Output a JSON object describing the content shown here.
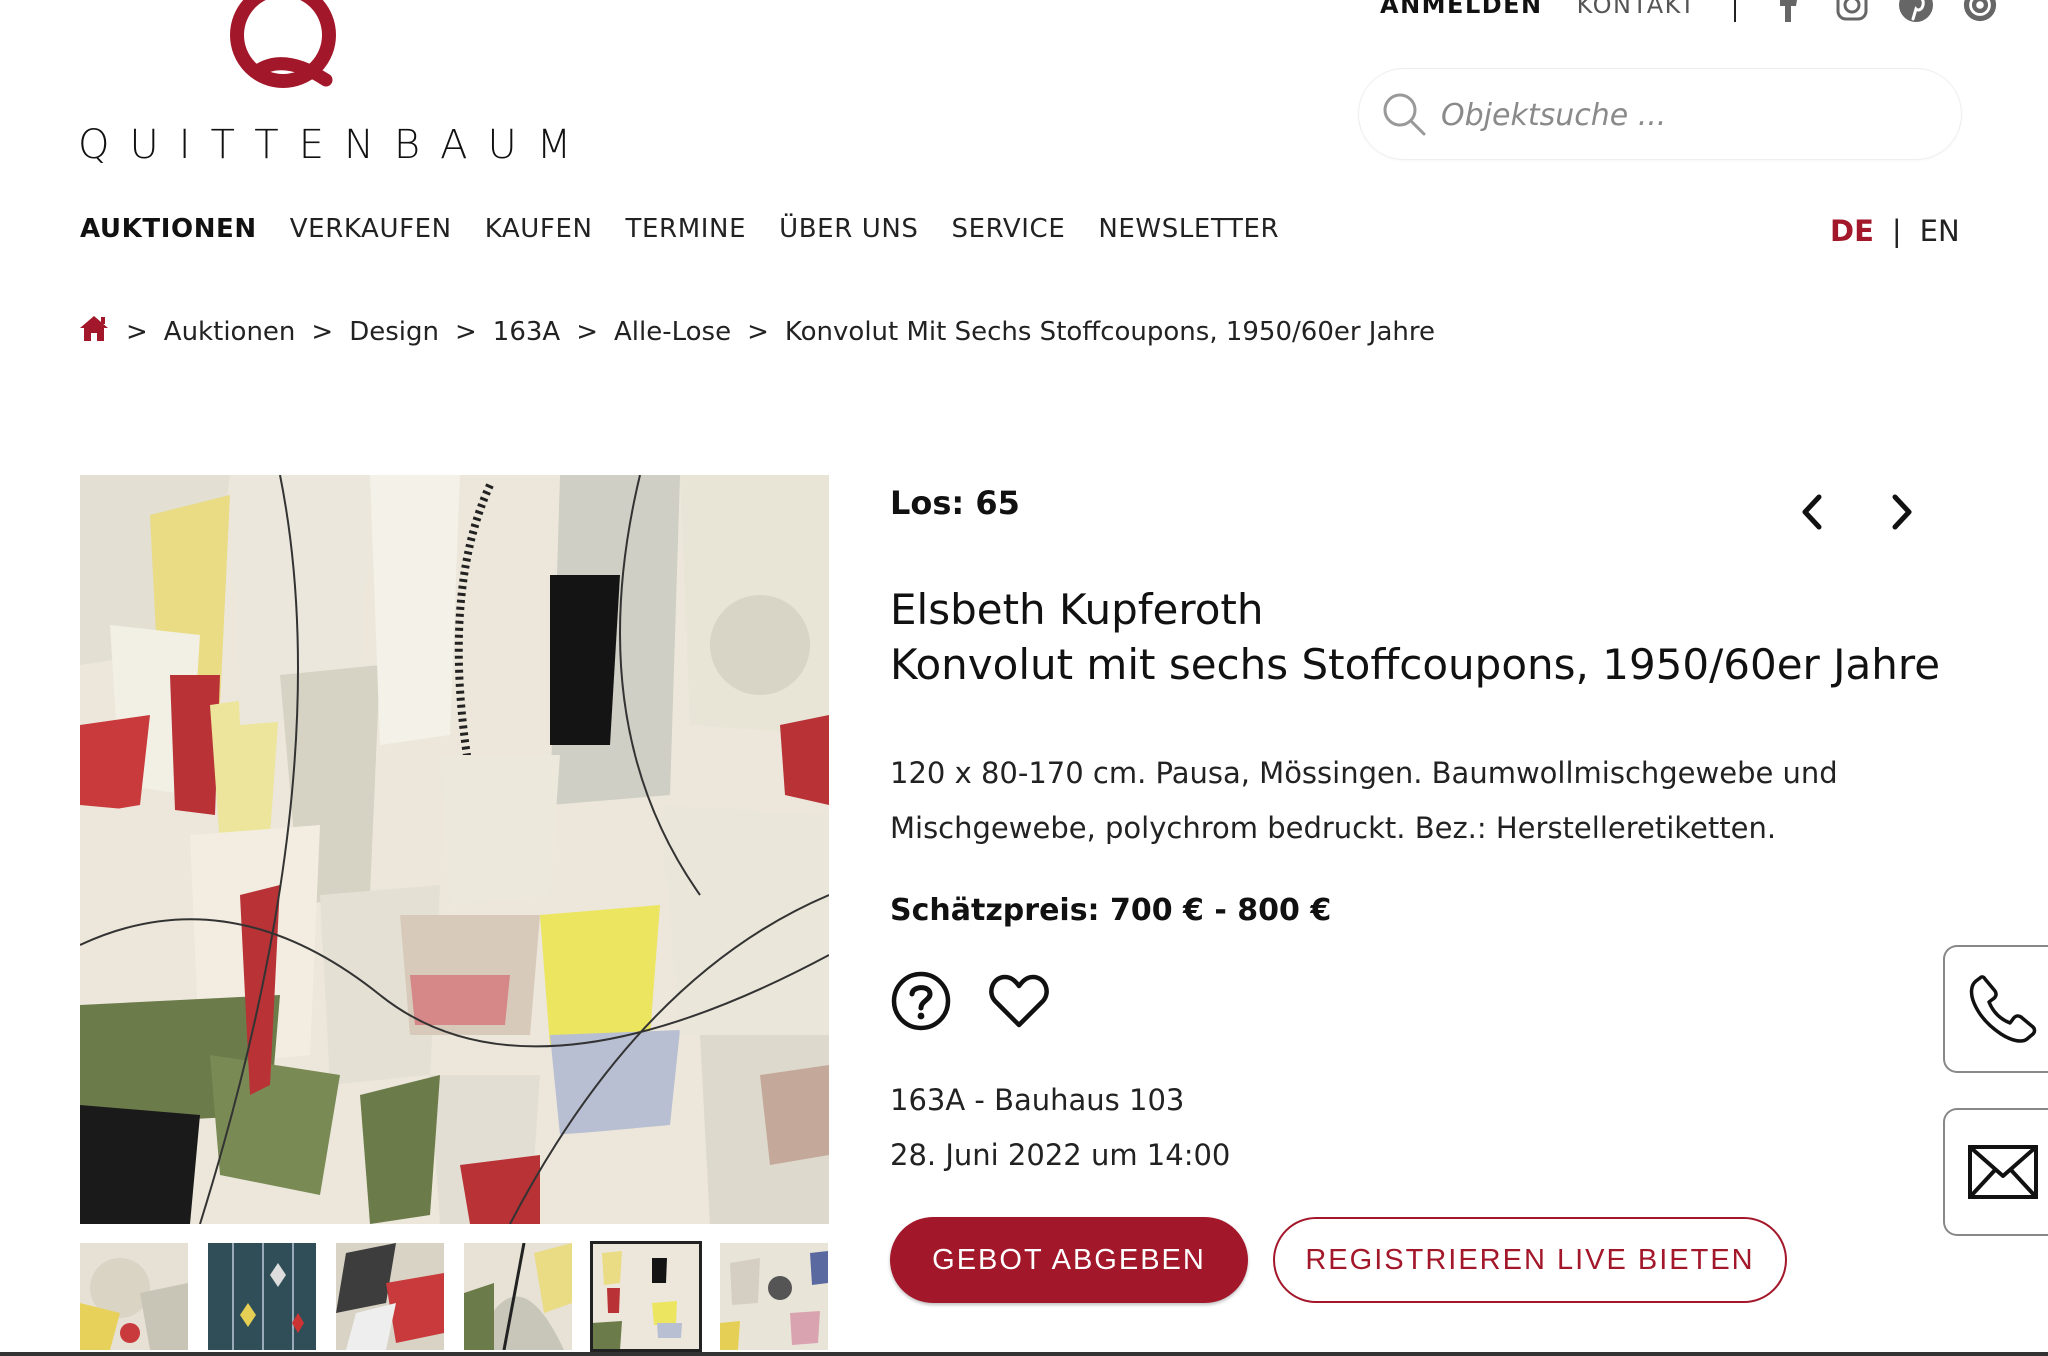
{
  "brand": {
    "name": "QUITTENBAUM",
    "accent_color": "#a3172a"
  },
  "topnav": {
    "login": "ANMELDEN",
    "contact": "KONTAKT",
    "social_icons": [
      "facebook-icon",
      "instagram-icon",
      "pinterest-icon",
      "issuu-icon"
    ]
  },
  "search": {
    "placeholder": "Objektsuche ..."
  },
  "mainnav": {
    "items": [
      "AUKTIONEN",
      "VERKAUFEN",
      "KAUFEN",
      "TERMINE",
      "ÜBER UNS",
      "SERVICE",
      "NEWSLETTER"
    ],
    "active": "AUKTIONEN"
  },
  "language": {
    "active": "DE",
    "divider": "|",
    "other": "EN"
  },
  "breadcrumb": {
    "separator": ">",
    "items": [
      "Auktionen",
      "Design",
      "163A",
      "Alle-Lose",
      "Konvolut Mit Sechs Stoffcoupons, 1950/60er Jahre"
    ]
  },
  "lot": {
    "number_label": "Los: 65",
    "artist": "Elsbeth Kupferoth",
    "title": "Konvolut mit sechs Stoffcoupons, 1950/60er Jahre",
    "description": "120 x 80-170 cm. Pausa, Mössingen. Baumwollmischgewebe und Mischgewebe, polychrom bedruckt. Bez.: Herstelleretiketten.",
    "estimate": "Schätzpreis: 700 € - 800 €",
    "sale_name": "163A - Bauhaus 103",
    "sale_date": "28. Juni 2022 um 14:00"
  },
  "buttons": {
    "bid": "GEBOT ABGEBEN",
    "live": "REGISTRIEREN LIVE BIETEN"
  },
  "gallery": {
    "thumbnail_count": 6,
    "selected_thumbnail": 5
  },
  "icons": {
    "question": "question-circle-icon",
    "favorite": "heart-icon",
    "prev": "chevron-left-icon",
    "next": "chevron-right-icon",
    "phone": "phone-icon",
    "mail": "mail-icon",
    "home": "home-icon",
    "search": "search-icon"
  }
}
